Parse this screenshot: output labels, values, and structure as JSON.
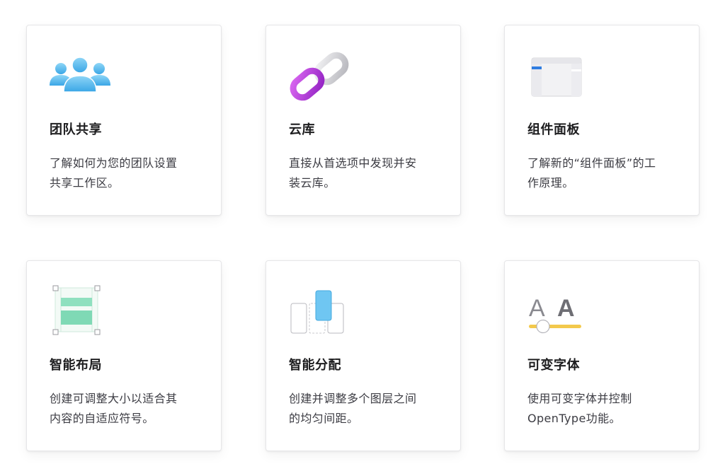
{
  "colors": {
    "card_border": "#e6e6e8",
    "title": "#1d1d1f",
    "description": "#3c3c43",
    "team_blue": "#5fbff0",
    "link_purple": "#b13fd6",
    "link_gray": "#c9c9ce",
    "panel_blue": "#2f7de1",
    "layout_green": "#7fd9b5",
    "distribute_blue": "#6fc6f2",
    "font_slider_yellow": "#f3c94c"
  },
  "cards": [
    {
      "icon": "team-people-icon",
      "title": "团队共享",
      "desc_line1": "了解如何为您的团队设置",
      "desc_line2": "共享工作区。"
    },
    {
      "icon": "chain-link-icon",
      "title": "云库",
      "desc_line1": "直接从首选项中发现并安",
      "desc_line2": "装云库。"
    },
    {
      "icon": "component-panel-icon",
      "title": "组件面板",
      "desc_line1": "了解新的“组件面板”的工",
      "desc_line2": "作原理。"
    },
    {
      "icon": "smart-layout-icon",
      "title": "智能布局",
      "desc_line1": "创建可调整大小以适合其",
      "desc_line2": "内容的自适应符号。"
    },
    {
      "icon": "smart-distribute-icon",
      "title": "智能分配",
      "desc_line1": "创建并调整多个图层之间",
      "desc_line2": "的均匀间距。"
    },
    {
      "icon": "variable-font-icon",
      "title": "可变字体",
      "desc_line1": "使用可变字体并控制",
      "desc_line2": "OpenType功能。",
      "icon_letters": "A A"
    }
  ]
}
